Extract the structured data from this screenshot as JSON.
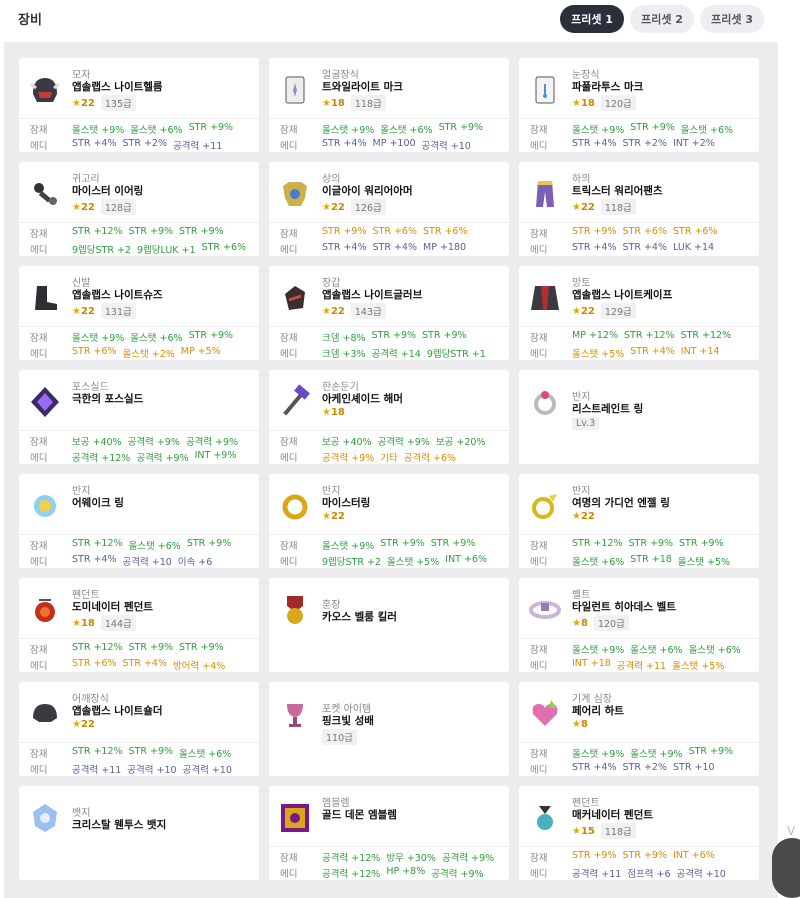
{
  "header": {
    "title": "장비",
    "presets": [
      "프리셋 1",
      "프리셋 2",
      "프리셋 3"
    ]
  },
  "items": [
    {
      "cat": "모자",
      "name": "앱솔랩스 나이트헬름",
      "star": "22",
      "lv": "135급",
      "icon": "helmet-icon",
      "r1": [
        [
          "올스탯 +9%",
          "g"
        ],
        [
          "올스탯 +6%",
          "g"
        ],
        [
          "STR +9%",
          "g"
        ]
      ],
      "r2": [
        [
          "STR +4%",
          "b"
        ],
        [
          "STR +2%",
          "b"
        ],
        [
          "공격력 +11",
          "b"
        ]
      ]
    },
    {
      "cat": "얼굴장식",
      "name": "트와일라이트 마크",
      "star": "18",
      "lv": "118급",
      "icon": "face-mark-icon",
      "r1": [
        [
          "올스탯 +9%",
          "g"
        ],
        [
          "올스탯 +6%",
          "g"
        ],
        [
          "STR +9%",
          "g"
        ]
      ],
      "r2": [
        [
          "STR +4%",
          "b"
        ],
        [
          "MP +100",
          "b"
        ],
        [
          "공격력 +10",
          "b"
        ]
      ]
    },
    {
      "cat": "눈장식",
      "name": "파풀라투스 마크",
      "star": "18",
      "lv": "120급",
      "icon": "eye-mark-icon",
      "r1": [
        [
          "올스탯 +9%",
          "g"
        ],
        [
          "STR +9%",
          "g"
        ],
        [
          "올스탯 +6%",
          "g"
        ]
      ],
      "r2": [
        [
          "STR +4%",
          "b"
        ],
        [
          "STR +2%",
          "b"
        ],
        [
          "INT +2%",
          "b"
        ]
      ]
    },
    {
      "cat": "귀고리",
      "name": "마이스터 이어링",
      "star": "22",
      "lv": "128급",
      "icon": "earring-icon",
      "r1": [
        [
          "STR +12%",
          "g"
        ],
        [
          "STR +9%",
          "g"
        ],
        [
          "STR +9%",
          "g"
        ]
      ],
      "r2": [
        [
          "9렙당STR +2",
          "g"
        ],
        [
          "9렙당LUK +1",
          "g"
        ],
        [
          "STR +6%",
          "g"
        ]
      ]
    },
    {
      "cat": "상의",
      "name": "이글아이 워리어아머",
      "star": "22",
      "lv": "126급",
      "icon": "armor-icon",
      "r1": [
        [
          "STR +9%",
          "o"
        ],
        [
          "STR +6%",
          "o"
        ],
        [
          "STR +6%",
          "o"
        ]
      ],
      "r2": [
        [
          "STR +4%",
          "b"
        ],
        [
          "STR +4%",
          "b"
        ],
        [
          "MP +180",
          "b"
        ]
      ]
    },
    {
      "cat": "하의",
      "name": "트릭스터 워리어팬츠",
      "star": "22",
      "lv": "118급",
      "icon": "pants-icon",
      "r1": [
        [
          "STR +9%",
          "o"
        ],
        [
          "STR +6%",
          "o"
        ],
        [
          "STR +6%",
          "o"
        ]
      ],
      "r2": [
        [
          "STR +4%",
          "b"
        ],
        [
          "STR +4%",
          "b"
        ],
        [
          "LUK +14",
          "b"
        ]
      ]
    },
    {
      "cat": "신발",
      "name": "앱솔랩스 나이트슈즈",
      "star": "22",
      "lv": "131급",
      "icon": "shoes-icon",
      "r1": [
        [
          "올스탯 +9%",
          "g"
        ],
        [
          "올스탯 +6%",
          "g"
        ],
        [
          "STR +9%",
          "g"
        ]
      ],
      "r2": [
        [
          "STR +6%",
          "o"
        ],
        [
          "올스탯 +2%",
          "o"
        ],
        [
          "MP +5%",
          "o"
        ]
      ]
    },
    {
      "cat": "장갑",
      "name": "앱솔랩스 나이트글러브",
      "star": "22",
      "lv": "143급",
      "icon": "glove-icon",
      "r1": [
        [
          "크뎀 +8%",
          "g"
        ],
        [
          "STR +9%",
          "g"
        ],
        [
          "STR +9%",
          "g"
        ]
      ],
      "r2": [
        [
          "크뎀 +3%",
          "g"
        ],
        [
          "공격력 +14",
          "g"
        ],
        [
          "9렙당STR +1",
          "g"
        ]
      ]
    },
    {
      "cat": "망토",
      "name": "앱솔랩스 나이트케이프",
      "star": "22",
      "lv": "129급",
      "icon": "cape-icon",
      "r1": [
        [
          "MP +12%",
          "g"
        ],
        [
          "STR +12%",
          "g"
        ],
        [
          "STR +12%",
          "g"
        ]
      ],
      "r2": [
        [
          "올스탯 +5%",
          "o"
        ],
        [
          "STR +4%",
          "o"
        ],
        [
          "INT +14",
          "o"
        ]
      ]
    },
    {
      "cat": "포스실드",
      "name": "극한의 포스실드",
      "star": "",
      "lv": "",
      "icon": "force-shield-icon",
      "r1": [
        [
          "보공 +40%",
          "g"
        ],
        [
          "공격력 +9%",
          "g"
        ],
        [
          "공격력 +9%",
          "g"
        ]
      ],
      "r2": [
        [
          "공격력 +12%",
          "g"
        ],
        [
          "공격력 +9%",
          "g"
        ],
        [
          "INT +9%",
          "g"
        ]
      ]
    },
    {
      "cat": "한손둔기",
      "name": "아케인셰이드 해머",
      "star": "18",
      "lv": "",
      "icon": "hammer-icon",
      "r1": [
        [
          "보공 +40%",
          "g"
        ],
        [
          "공격력 +9%",
          "g"
        ],
        [
          "보공 +20%",
          "g"
        ]
      ],
      "r2": [
        [
          "공격력 +9%",
          "o"
        ],
        [
          "기타",
          "o"
        ],
        [
          "공격력 +6%",
          "o"
        ]
      ]
    },
    {
      "cat": "반지",
      "name": "리스트레인트 링",
      "star": "",
      "lv": "Lv.3",
      "icon": "ring-icon",
      "r1": [],
      "r2": []
    },
    {
      "cat": "반지",
      "name": "어웨이크 링",
      "star": "",
      "lv": "",
      "icon": "awake-ring-icon",
      "r1": [
        [
          "STR +12%",
          "g"
        ],
        [
          "올스탯 +6%",
          "g"
        ],
        [
          "STR +9%",
          "g"
        ]
      ],
      "r2": [
        [
          "STR +4%",
          "b"
        ],
        [
          "공격력 +10",
          "b"
        ],
        [
          "이속 +6",
          "b"
        ]
      ]
    },
    {
      "cat": "반지",
      "name": "마이스터링",
      "star": "22",
      "lv": "",
      "icon": "meister-ring-icon",
      "r1": [
        [
          "올스탯 +9%",
          "g"
        ],
        [
          "STR +9%",
          "g"
        ],
        [
          "STR +9%",
          "g"
        ]
      ],
      "r2": [
        [
          "9렙당STR +2",
          "g"
        ],
        [
          "올스탯 +5%",
          "g"
        ],
        [
          "INT +6%",
          "g"
        ]
      ]
    },
    {
      "cat": "반지",
      "name": "여명의 가디언 엔젤 링",
      "star": "22",
      "lv": "",
      "icon": "angel-ring-icon",
      "r1": [
        [
          "STR +12%",
          "g"
        ],
        [
          "STR +9%",
          "g"
        ],
        [
          "STR +9%",
          "g"
        ]
      ],
      "r2": [
        [
          "올스탯 +6%",
          "g"
        ],
        [
          "STR +18",
          "g"
        ],
        [
          "올스탯 +5%",
          "g"
        ]
      ]
    },
    {
      "cat": "펜던트",
      "name": "도미네이터 펜던트",
      "star": "18",
      "lv": "144급",
      "icon": "pendant-icon",
      "r1": [
        [
          "STR +12%",
          "g"
        ],
        [
          "STR +9%",
          "g"
        ],
        [
          "STR +9%",
          "g"
        ]
      ],
      "r2": [
        [
          "STR +6%",
          "o"
        ],
        [
          "STR +4%",
          "o"
        ],
        [
          "방어력 +4%",
          "o"
        ]
      ]
    },
    {
      "cat": "훈장",
      "name": "카오스 벨룸 킬러",
      "star": "",
      "lv": "",
      "icon": "medal-icon",
      "r1": [],
      "r2": []
    },
    {
      "cat": "벨트",
      "name": "타일런트 히아데스 벨트",
      "star": "8",
      "lv": "120급",
      "icon": "belt-icon",
      "r1": [
        [
          "올스탯 +9%",
          "g"
        ],
        [
          "올스탯 +6%",
          "g"
        ],
        [
          "올스탯 +6%",
          "g"
        ]
      ],
      "r2": [
        [
          "INT +18",
          "o"
        ],
        [
          "공격력 +11",
          "o"
        ],
        [
          "올스탯 +5%",
          "o"
        ]
      ]
    },
    {
      "cat": "어깨장식",
      "name": "앱솔랩스 나이트숄더",
      "star": "22",
      "lv": "",
      "icon": "shoulder-icon",
      "r1": [
        [
          "STR +12%",
          "g"
        ],
        [
          "STR +9%",
          "g"
        ],
        [
          "올스탯 +6%",
          "g"
        ]
      ],
      "r2": [
        [
          "공격력 +11",
          "b"
        ],
        [
          "공격력 +10",
          "b"
        ],
        [
          "공격력 +10",
          "b"
        ]
      ]
    },
    {
      "cat": "포켓 아이템",
      "name": "핑크빛 성배",
      "star": "",
      "lv": "110급",
      "icon": "chalice-icon",
      "r1": [],
      "r2": []
    },
    {
      "cat": "기계 심장",
      "name": "페어리 하트",
      "star": "8",
      "lv": "",
      "icon": "heart-icon",
      "r1": [
        [
          "올스탯 +9%",
          "g"
        ],
        [
          "올스탯 +9%",
          "g"
        ],
        [
          "STR +9%",
          "g"
        ]
      ],
      "r2": [
        [
          "STR +4%",
          "b"
        ],
        [
          "STR +2%",
          "b"
        ],
        [
          "STR +10",
          "b"
        ]
      ]
    },
    {
      "cat": "뱃지",
      "name": "크리스탈 웬투스 뱃지",
      "star": "",
      "lv": "",
      "icon": "badge-icon",
      "r1": [],
      "r2": []
    },
    {
      "cat": "엠블렘",
      "name": "골드 데몬 엠블렘",
      "star": "",
      "lv": "",
      "icon": "emblem-icon",
      "r1": [
        [
          "공격력 +12%",
          "g"
        ],
        [
          "방무 +30%",
          "g"
        ],
        [
          "공격력 +9%",
          "g"
        ]
      ],
      "r2": [
        [
          "공격력 +12%",
          "g"
        ],
        [
          "HP +8%",
          "g"
        ],
        [
          "공격력 +9%",
          "g"
        ]
      ]
    },
    {
      "cat": "펜던트",
      "name": "매커네이터 펜던트",
      "star": "15",
      "lv": "118급",
      "icon": "pendant2-icon",
      "r1": [
        [
          "STR +9%",
          "o"
        ],
        [
          "STR +9%",
          "o"
        ],
        [
          "INT +6%",
          "o"
        ]
      ],
      "r2": [
        [
          "공격력 +11",
          "b"
        ],
        [
          "점프력 +6",
          "b"
        ],
        [
          "공격력 +10",
          "b"
        ]
      ]
    }
  ],
  "labels": {
    "row1": "잠재",
    "row2": "에디",
    "star_glyph": "★"
  },
  "edge": {
    "v": "V"
  }
}
